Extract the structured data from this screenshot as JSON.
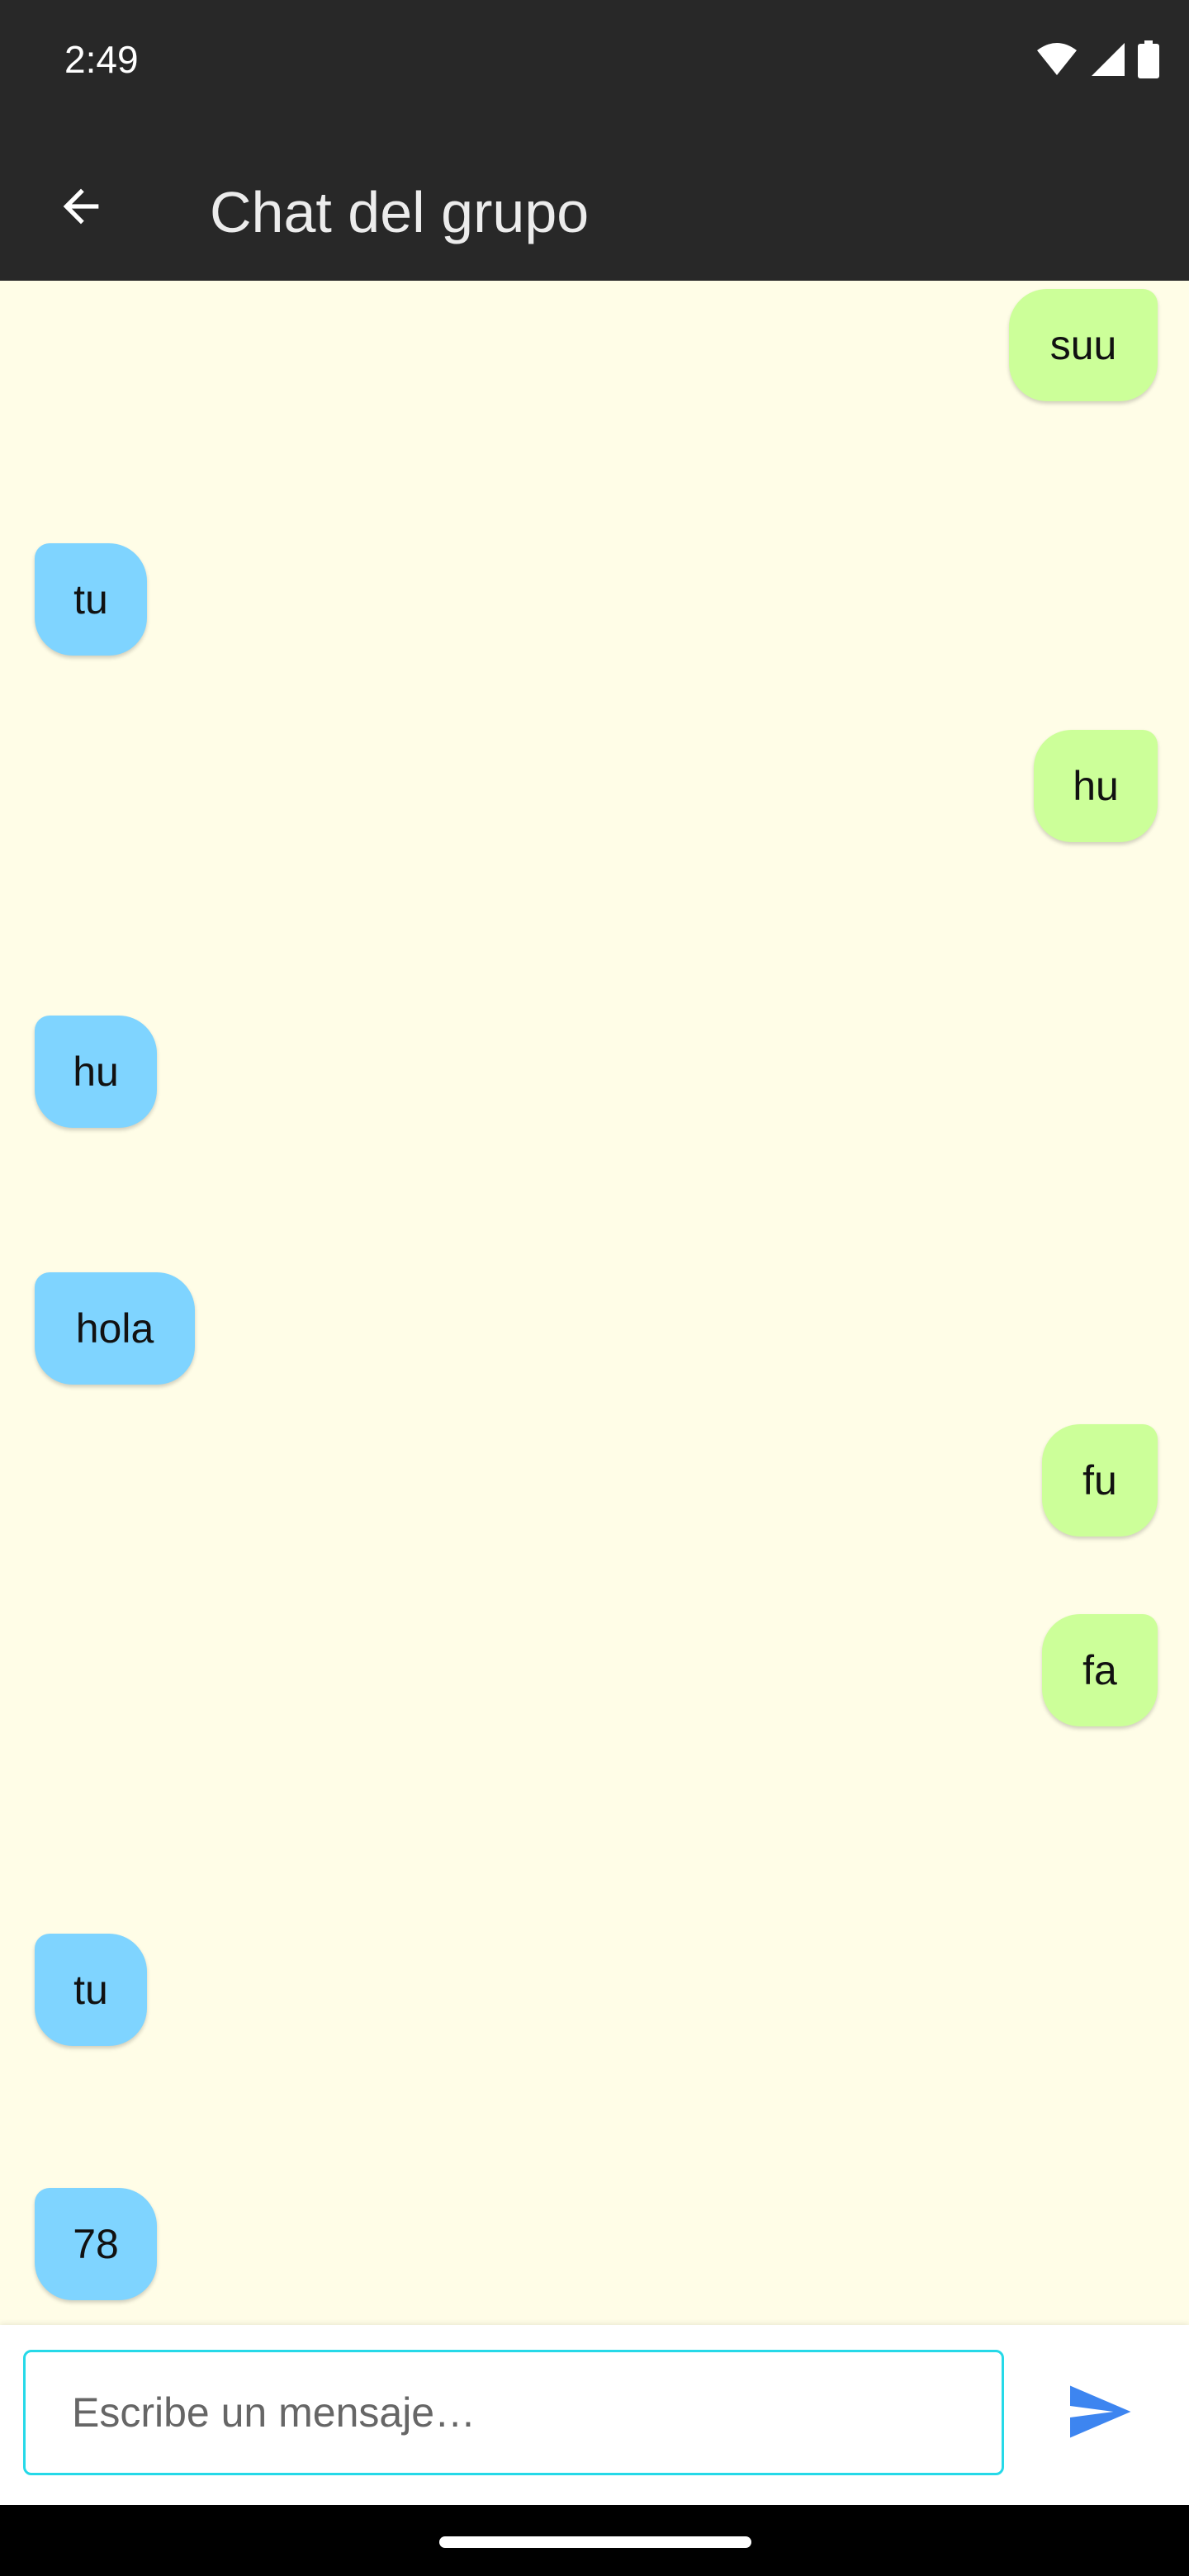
{
  "status_bar": {
    "time": "2:49",
    "icons": [
      "wifi-icon",
      "signal-icon",
      "battery-icon"
    ]
  },
  "app_bar": {
    "back_icon": "arrow-back-icon",
    "title": "Chat del grupo"
  },
  "messages": [
    {
      "direction": "outgoing",
      "text": "suu"
    },
    {
      "direction": "incoming",
      "text": "tu"
    },
    {
      "direction": "outgoing",
      "text": "hu"
    },
    {
      "direction": "incoming",
      "text": "hu"
    },
    {
      "direction": "incoming",
      "text": "hola"
    },
    {
      "direction": "outgoing",
      "text": "fu"
    },
    {
      "direction": "outgoing",
      "text": "fa"
    },
    {
      "direction": "incoming",
      "text": "tu"
    },
    {
      "direction": "incoming",
      "text": "78"
    }
  ],
  "composer": {
    "placeholder": "Escribe un mensaje…",
    "value": "",
    "send_icon": "send-icon"
  },
  "colors": {
    "bar_background": "#282828",
    "chat_background": "#fffde7",
    "incoming_bubble": "#7fd4ff",
    "outgoing_bubble": "#ccff99",
    "input_border": "#26d9e8",
    "send_accent": "#3d85f0"
  }
}
